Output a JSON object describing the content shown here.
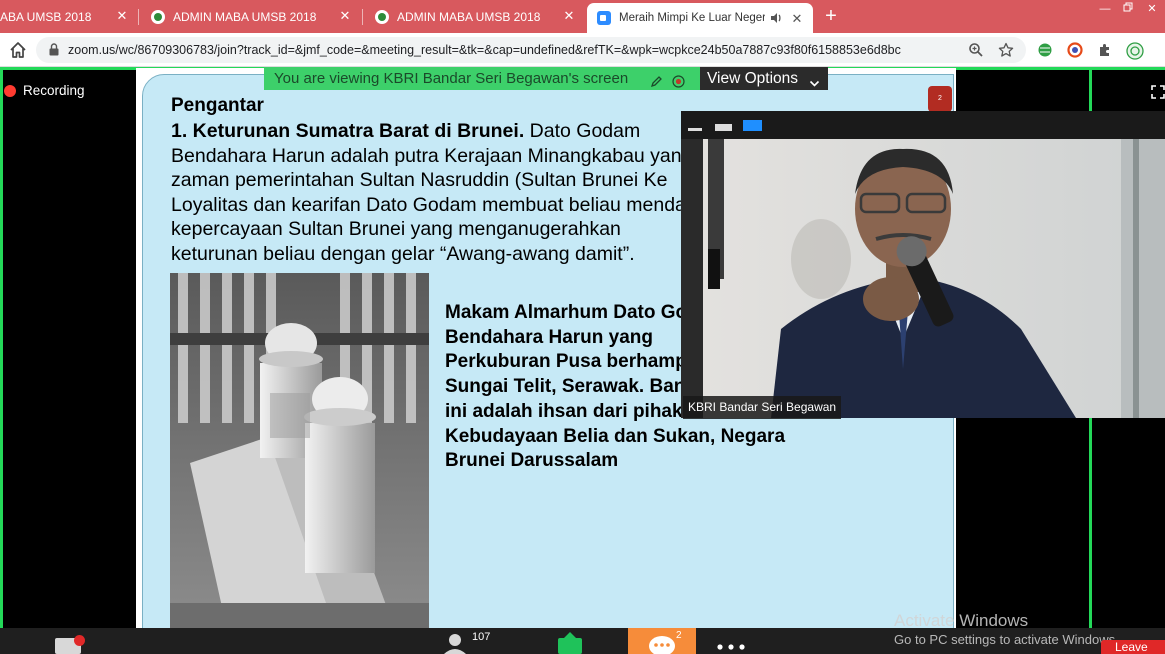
{
  "browser": {
    "tabs": [
      {
        "label": "ABA UMSB 2018",
        "active": false
      },
      {
        "label": "ADMIN MABA UMSB 2018",
        "active": false
      },
      {
        "label": "ADMIN MABA UMSB 2018",
        "active": false
      },
      {
        "label": "Meraih Mimpi Ke Luar Neger",
        "active": true
      }
    ],
    "new_tab": "+",
    "url": "zoom.us/wc/86709306783/join?track_id=&jmf_code=&meeting_result=&tk=&cap=undefined&refTK=&wpk=wcpkce24b50a7887c93f80f6158853e6d8bc",
    "tab_bar_color": "#d8595e"
  },
  "meeting": {
    "recording_label": "Recording",
    "viewing_banner": "You are viewing KBRI Bandar Seri Begawan's screen",
    "view_options": "View Options",
    "accent_green": "#23d959"
  },
  "slide": {
    "title": "Pengantar",
    "para_lead": "1. Keturunan Sumatra Barat di Brunei.",
    "para_lines": [
      "Dato Godam",
      "Bendahara Harun adalah putra Kerajaan Minangkabau yang",
      "zaman pemerintahan Sultan Nasruddin (Sultan Brunei Ke",
      "Loyalitas dan kearifan Dato Godam membuat beliau mendapat",
      "kepercayaan Sultan Brunei yang menganugerahkan",
      "keturunan beliau dengan gelar “Awang-awang damit”."
    ],
    "caption_lines": [
      "Makam Almarhum Dato Godam",
      "Bendahara Harun yang",
      "Perkuburan Pusa berhampiran",
      "Sungai Telit, Serawak. Bangunan",
      "ini adalah ihsan dari pihak",
      "Kebudayaan Belia dan Sukan, Negara",
      "Brunei Darussalam"
    ],
    "page_badge": "2"
  },
  "video": {
    "participant_name": "KBRI Bandar Seri Begawan"
  },
  "toolbar": {
    "participants_count": "107",
    "chat_count": "2",
    "leave_label": "Leave",
    "chat_color": "#f68c3a",
    "leave_color": "#e02828"
  },
  "windows": {
    "watermark_title": "Activate Windows",
    "watermark_sub": "Go to PC settings to activate Windows."
  }
}
